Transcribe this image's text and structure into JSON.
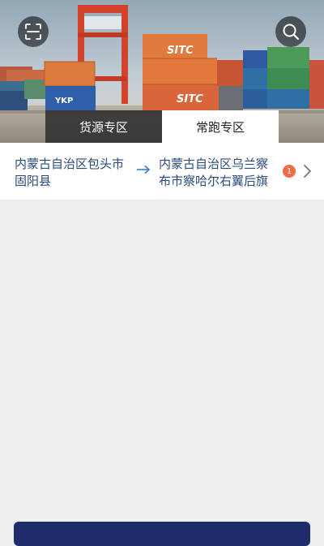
{
  "header": {
    "scan_icon": "scan-icon",
    "search_icon": "search-icon",
    "container_brand": "SITC",
    "container_brand_small": "YKP"
  },
  "tabs": [
    {
      "label": "货源专区",
      "active": false
    },
    {
      "label": "常跑专区",
      "active": true
    }
  ],
  "route": {
    "origin": "内蒙古自治区包头市\n固阳县",
    "destination": "内蒙古自治区乌兰察\n布市察哈尔右翼后旗",
    "count": "1"
  },
  "colors": {
    "accent_text": "#2a4a7a",
    "badge": "#f26b47",
    "bottom_button": "#1d2d6b",
    "page_bg": "#efefef"
  }
}
